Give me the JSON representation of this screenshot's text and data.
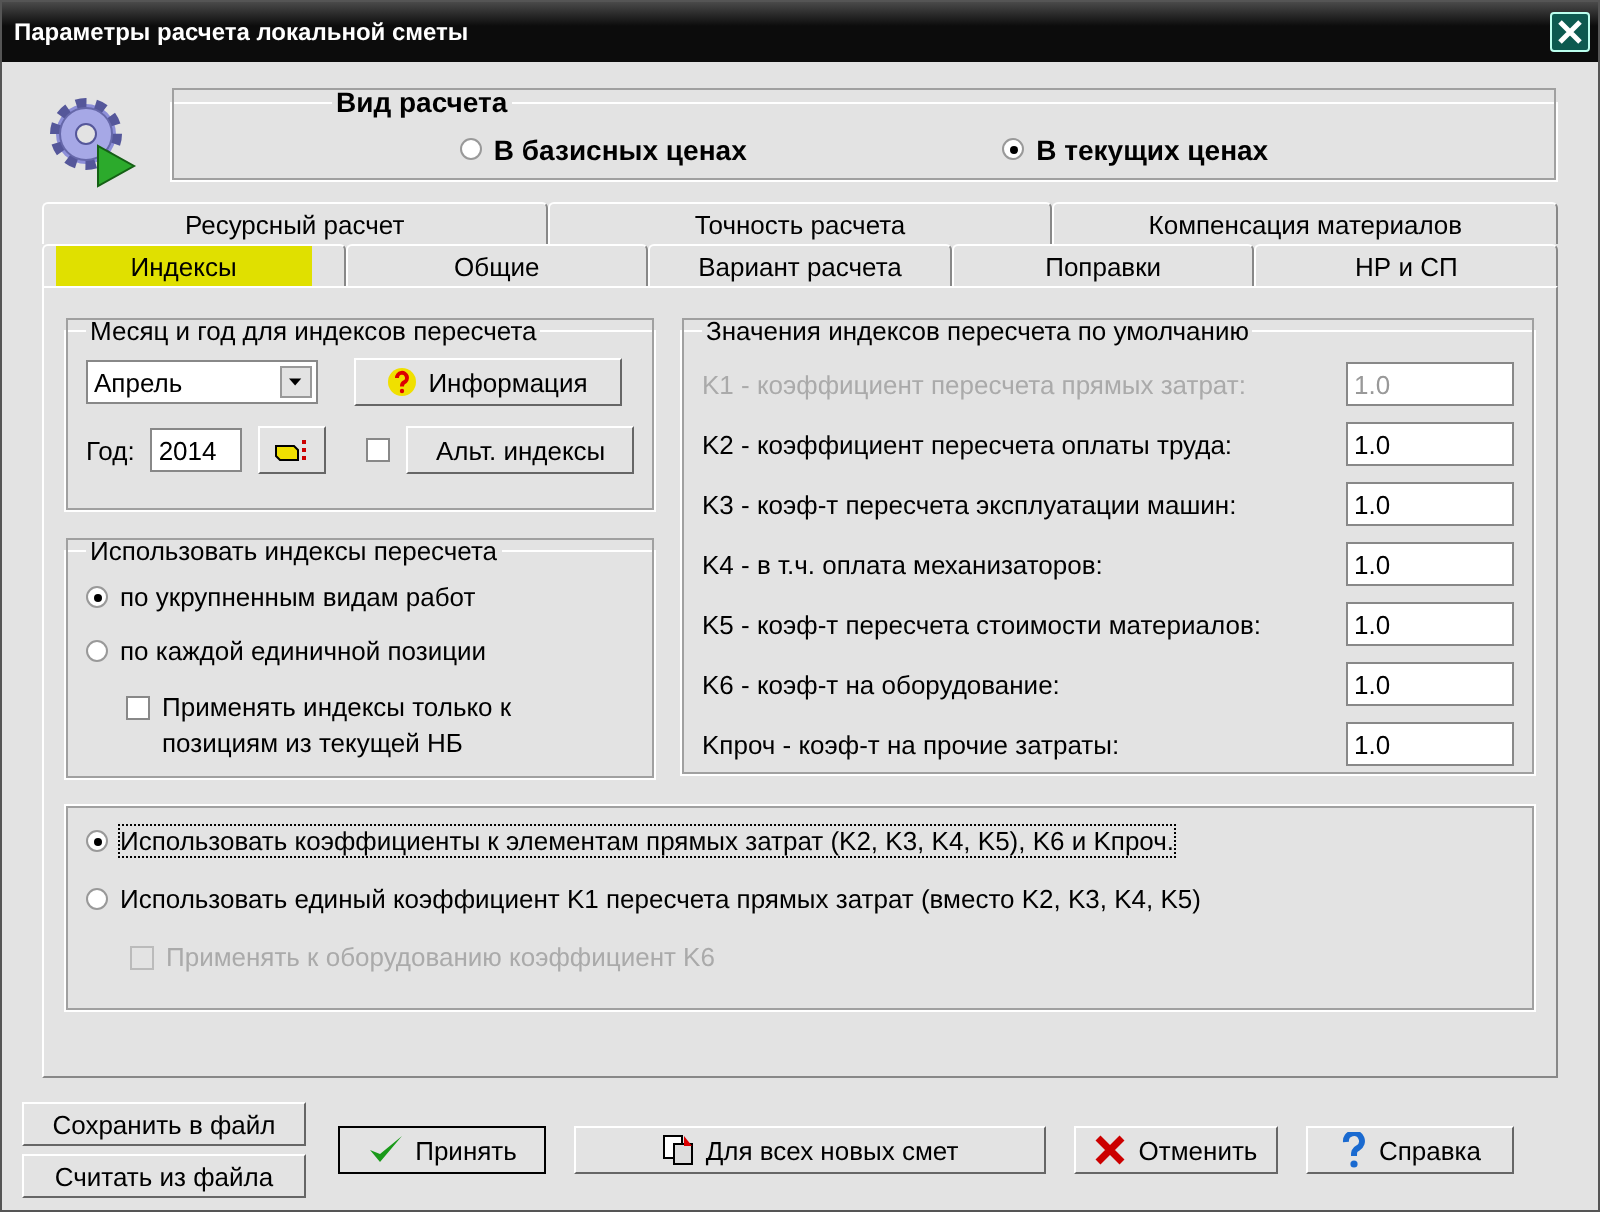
{
  "window": {
    "title": "Параметры расчета локальной сметы"
  },
  "calc_type": {
    "legend": "Вид расчета",
    "options": [
      {
        "label": "В базисных ценах",
        "selected": false
      },
      {
        "label": "В текущих ценах",
        "selected": true
      }
    ]
  },
  "tab_rows": [
    {
      "tabs": [
        {
          "label": "Ресурсный расчет",
          "selected": false
        },
        {
          "label": "Точность расчета",
          "selected": false
        },
        {
          "label": "Компенсация материалов",
          "selected": false
        }
      ]
    },
    {
      "tabs": [
        {
          "label": "Индексы",
          "selected": true
        },
        {
          "label": "Общие",
          "selected": false
        },
        {
          "label": "Вариант расчета",
          "selected": false
        },
        {
          "label": "Поправки",
          "selected": false
        },
        {
          "label": "НР и СП",
          "selected": false
        }
      ]
    }
  ],
  "month_group": {
    "legend": "Месяц и год для индексов пересчета",
    "month": "Апрель",
    "info_button": "Информация",
    "year_label": "Год:",
    "year": "2014",
    "alt_checked": false,
    "alt_button": "Альт. индексы"
  },
  "use_indices": {
    "legend": "Использовать индексы пересчета",
    "options": [
      {
        "label": "по укрупненным видам работ",
        "selected": true
      },
      {
        "label": "по каждой единичной позиции",
        "selected": false
      }
    ],
    "only_current": {
      "label": "Применять индексы только к позициям из текущей НБ",
      "checked": false
    }
  },
  "defaults": {
    "legend": "Значения индексов пересчета по умолчанию",
    "rows": [
      {
        "label": "K1 - коэффициент пересчета прямых затрат:",
        "value": "1.0",
        "disabled": true
      },
      {
        "label": "K2 - коэффициент пересчета оплаты труда:",
        "value": "1.0",
        "disabled": false
      },
      {
        "label": "K3 - коэф-т пересчета эксплуатации машин:",
        "value": "1.0",
        "disabled": false
      },
      {
        "label": "K4 - в т.ч. оплата механизаторов:",
        "value": "1.0",
        "disabled": false
      },
      {
        "label": "K5 - коэф-т пересчета стоимости материалов:",
        "value": "1.0",
        "disabled": false
      },
      {
        "label": "K6 - коэф-т на оборудование:",
        "value": "1.0",
        "disabled": false
      },
      {
        "label": "Kпроч - коэф-т на прочие затраты:",
        "value": "1.0",
        "disabled": false
      }
    ]
  },
  "mode": {
    "options": [
      {
        "label": "Использовать коэффициенты к элементам прямых затрат (K2, K3, K4, K5), K6 и Kпроч.",
        "selected": true
      },
      {
        "label": "Использовать единый коэффициент K1 пересчета прямых затрат (вместо K2, K3, K4, K5)",
        "selected": false
      }
    ],
    "equipment": {
      "label": "Применять к оборудованию коэффициент K6",
      "checked": false,
      "disabled": true
    }
  },
  "file_buttons": [
    "Сохранить в файл",
    "Считать из файла"
  ],
  "buttons": [
    {
      "kind": "accept",
      "label": "Принять"
    },
    {
      "kind": "all",
      "label": "Для всех новых смет"
    },
    {
      "kind": "cancel",
      "label": "Отменить"
    },
    {
      "kind": "help",
      "label": "Справка"
    }
  ]
}
